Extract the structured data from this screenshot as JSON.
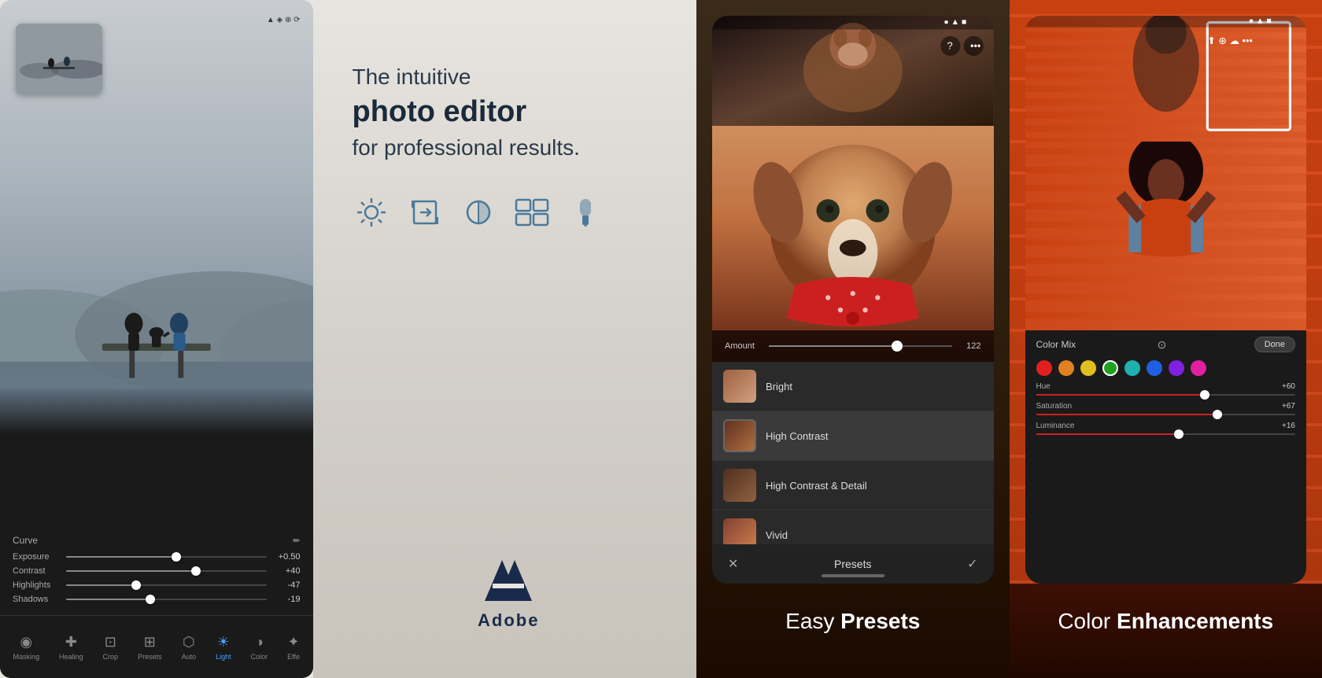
{
  "panels": [
    {
      "id": "panel-1",
      "type": "lightroom-edit",
      "status_bar": "●▲■",
      "thumbnail_alt": "People on dock thumbnail",
      "curve_label": "Curve",
      "edit_icon": "✏",
      "controls": [
        {
          "name": "Exposure",
          "value": "+0.50",
          "fill_pct": 55
        },
        {
          "name": "Contrast",
          "value": "+40",
          "fill_pct": 65
        },
        {
          "name": "Highlights",
          "value": "-47",
          "fill_pct": 35
        },
        {
          "name": "Shadows",
          "value": "-19",
          "fill_pct": 42
        }
      ],
      "toolbar_items": [
        {
          "label": "Masking",
          "icon": "◉",
          "active": false
        },
        {
          "label": "Healing",
          "icon": "✚",
          "active": false
        },
        {
          "label": "Crop",
          "icon": "⊡",
          "active": false
        },
        {
          "label": "Presets",
          "icon": "⊞",
          "active": false
        },
        {
          "label": "Auto",
          "icon": "⬡",
          "active": false
        },
        {
          "label": "Light",
          "icon": "☀",
          "active": true
        },
        {
          "label": "Color",
          "icon": "◑",
          "active": false
        },
        {
          "label": "Effe",
          "icon": "✦",
          "active": false
        }
      ]
    },
    {
      "id": "panel-2",
      "type": "promo",
      "tagline_line1": "The intuitive",
      "tagline_line2": "photo editor",
      "tagline_line3": "for professional results.",
      "tool_icons": [
        "☼",
        "⟲",
        "◎",
        "⊞",
        "✐"
      ],
      "adobe_logo_text": "Adobe"
    },
    {
      "id": "panel-3",
      "type": "presets",
      "amount_label": "Amount",
      "amount_value": "122",
      "presets": [
        {
          "name": "Bright",
          "selected": false
        },
        {
          "name": "High Contrast",
          "selected": true
        },
        {
          "name": "High Contrast & Detail",
          "selected": false
        },
        {
          "name": "Vivid",
          "selected": false
        }
      ],
      "cancel_icon": "✕",
      "presets_label": "Presets",
      "confirm_icon": "✓",
      "caption_normal": "Easy ",
      "caption_bold": "Presets"
    },
    {
      "id": "panel-4",
      "type": "color-enhance",
      "color_mix_label": "Color Mix",
      "done_label": "Done",
      "color_dots": [
        {
          "color": "#e02020",
          "selected": false
        },
        {
          "color": "#e08020",
          "selected": false
        },
        {
          "color": "#20a020",
          "selected": false
        },
        {
          "color": "#20c040",
          "selected": true
        },
        {
          "color": "#20b0b0",
          "selected": false
        },
        {
          "color": "#2060e0",
          "selected": false
        },
        {
          "color": "#8020e0",
          "selected": false
        },
        {
          "color": "#e020a0",
          "selected": false
        }
      ],
      "sliders": [
        {
          "name": "Hue",
          "value": "+60",
          "fill_pct": 65,
          "fill_class": "p4-slider-fill-red"
        },
        {
          "name": "Saturation",
          "value": "+67",
          "fill_pct": 70,
          "fill_class": "p4-slider-fill-blue"
        },
        {
          "name": "Luminance",
          "value": "+16",
          "fill_pct": 55,
          "fill_class": "p4-slider-fill-green"
        }
      ],
      "caption_normal": "Color ",
      "caption_bold": "Enhancements"
    }
  ]
}
